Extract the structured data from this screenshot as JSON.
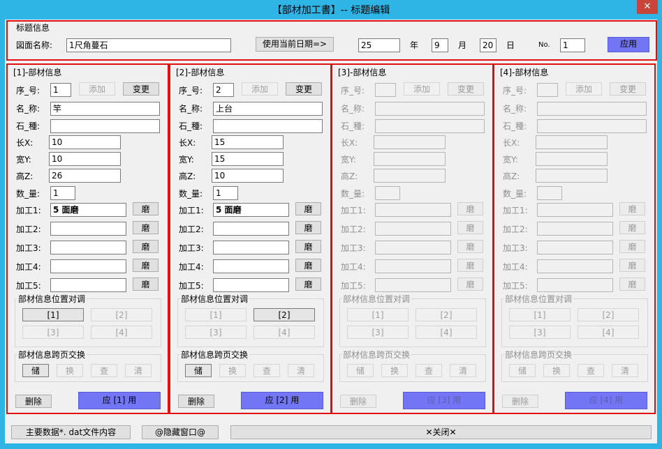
{
  "window": {
    "title": "【部材加工書】-- 标题编辑",
    "close_label": "✕"
  },
  "header": {
    "group_label": "标题信息",
    "drawing_name_label": "図面名称:",
    "drawing_name_value": "1尺角蔓石",
    "use_date_button": "使用当前日期=>",
    "year_value": "25",
    "year_label": "年",
    "month_value": "9",
    "month_label": "月",
    "day_value": "20",
    "day_label": "日",
    "no_label": "No.",
    "no_value": "1",
    "apply_button": "应用"
  },
  "common": {
    "seq_label": "序_号:",
    "add_button": "添加",
    "change_button": "变更",
    "name_label": "名_称:",
    "stone_label": "石_種:",
    "length_label": "长X:",
    "width_label": "宽Y:",
    "height_label": "高Z:",
    "qty_label": "数_量:",
    "proc_labels": [
      "加工1:",
      "加工2:",
      "加工3:",
      "加工4:",
      "加工5:"
    ],
    "grind_button": "磨",
    "swap_group_label": "部材信息位置对调",
    "swap_buttons": [
      "[1]",
      "[2]",
      "[3]",
      "[4]"
    ],
    "cross_group_label": "部材信息跨页交换",
    "cross_buttons": [
      "储",
      "换",
      "查",
      "清"
    ],
    "delete_button": "删除"
  },
  "panels": [
    {
      "title": "[1]-部材信息",
      "seq": "1",
      "name": "竿",
      "stone": "",
      "x": "10",
      "y": "10",
      "z": "26",
      "qty": "1",
      "procs": [
        "5 面磨",
        "",
        "",
        "",
        ""
      ],
      "apply": "应 [1] 用"
    },
    {
      "title": "[2]-部材信息",
      "seq": "2",
      "name": "上台",
      "stone": "",
      "x": "15",
      "y": "15",
      "z": "10",
      "qty": "1",
      "procs": [
        "5 面磨",
        "",
        "",
        "",
        ""
      ],
      "apply": "应 [2] 用"
    },
    {
      "title": "[3]-部材信息",
      "seq": "",
      "name": "",
      "stone": "",
      "x": "",
      "y": "",
      "z": "",
      "qty": "",
      "procs": [
        "",
        "",
        "",
        "",
        ""
      ],
      "apply": "应 [3] 用"
    },
    {
      "title": "[4]-部材信息",
      "seq": "",
      "name": "",
      "stone": "",
      "x": "",
      "y": "",
      "z": "",
      "qty": "",
      "procs": [
        "",
        "",
        "",
        "",
        ""
      ],
      "apply": "应 [4] 用"
    }
  ],
  "footer": {
    "main_data_button": "主要数据*. dat文件内容",
    "hide_window_button": "@隐藏窗口@",
    "close_button": "✕关闭✕"
  }
}
